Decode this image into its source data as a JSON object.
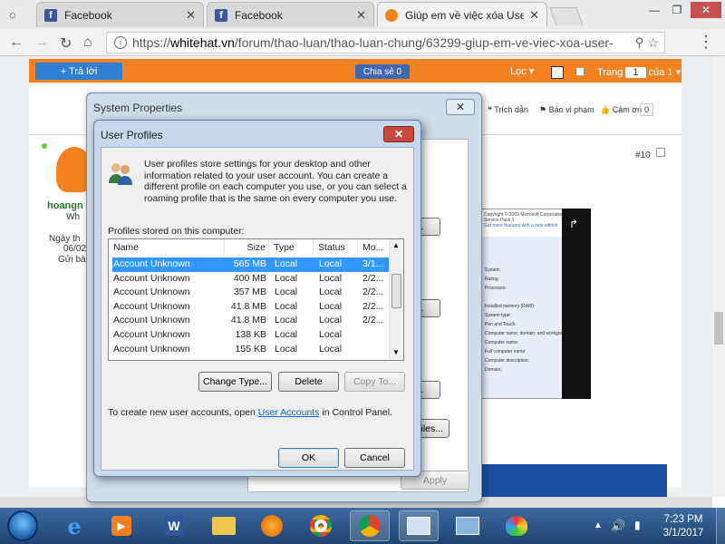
{
  "browser": {
    "tabs": [
      {
        "label": "Facebook",
        "icon": "facebook-icon"
      },
      {
        "label": "Facebook",
        "icon": "facebook-icon"
      },
      {
        "label": "Giúp em về việc xóa User",
        "icon": "whitehat-icon"
      }
    ],
    "url_host": "whitehat.vn",
    "url_path": "/forum/thao-luan/thao-luan-chung/63299-giup-em-ve-viec-xoa-user-",
    "url_scheme": "https://"
  },
  "forum": {
    "reply_label": "+ Trả lời",
    "share_label": "Chia sẻ 0",
    "filter_label": "Lọc",
    "page_label": "Trang",
    "page_current": "1",
    "page_of": "của 1",
    "quote_label": "Trích dẫn",
    "report_label": "Báo vi phạm",
    "thanks_label": "Cảm ơn",
    "thanks_count": "0",
    "post_number": "#10",
    "username": "hoangn",
    "user_rank": "Wh",
    "join_label": "Ngày th",
    "join_date": "06/02",
    "posts_label": "Gửi bà"
  },
  "system_properties": {
    "title": "System Properties",
    "apply_label": "Apply",
    "partial_buttons": [
      "...",
      "...",
      "...",
      "iles..."
    ]
  },
  "user_profiles": {
    "title": "User Profiles",
    "description": "User profiles store settings for your desktop and other information related to your user account. You can create a different profile on each computer you use, or you can select a roaming profile that is the same on every computer you use.",
    "profiles_label": "Profiles stored on this computer:",
    "columns": [
      "Name",
      "Size",
      "Type",
      "Status",
      "Mo..."
    ],
    "rows": [
      {
        "name": "Account Unknown",
        "size": "565 MB",
        "type": "Local",
        "status": "Local",
        "modified": "3/1..."
      },
      {
        "name": "Account Unknown",
        "size": "400 MB",
        "type": "Local",
        "status": "Local",
        "modified": "2/2..."
      },
      {
        "name": "Account Unknown",
        "size": "357 MB",
        "type": "Local",
        "status": "Local",
        "modified": "2/2..."
      },
      {
        "name": "Account Unknown",
        "size": "41.8 MB",
        "type": "Local",
        "status": "Local",
        "modified": "2/2..."
      },
      {
        "name": "Account Unknown",
        "size": "41.8 MB",
        "type": "Local",
        "status": "Local",
        "modified": "2/2..."
      },
      {
        "name": "Account Unknown",
        "size": "138 KB",
        "type": "Local",
        "status": "Local",
        "modified": ""
      },
      {
        "name": "Account Unknown",
        "size": "155 KB",
        "type": "Local",
        "status": "Local",
        "modified": ""
      }
    ],
    "change_type_label": "Change Type...",
    "delete_label": "Delete",
    "copy_to_label": "Copy To...",
    "create_note_prefix": "To create new user accounts, open ",
    "create_note_link": "User Accounts",
    "create_note_suffix": " in Control Panel.",
    "ok_label": "OK",
    "cancel_label": "Cancel"
  },
  "taskbar": {
    "time": "7:23 PM",
    "date": "3/1/2017",
    "apps": [
      "internet-explorer-icon",
      "media-player-icon",
      "word-icon",
      "file-explorer-icon",
      "firefox-icon",
      "chrome-icon",
      "chrome-icon",
      "system-icon",
      "network-icon",
      "paint-icon"
    ]
  },
  "colors": {
    "accent_orange": "#f58220",
    "selection_blue": "#3399ff",
    "facebook_blue": "#3b5998"
  }
}
